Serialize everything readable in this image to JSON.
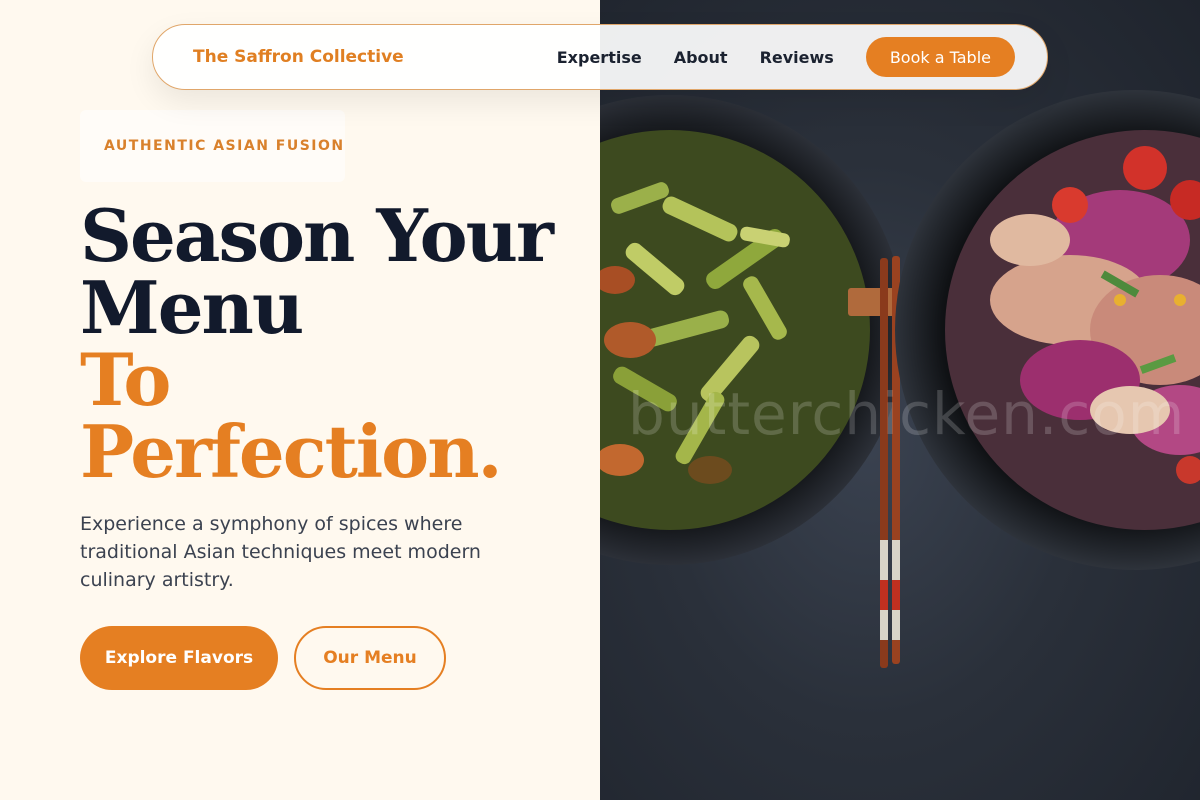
{
  "nav": {
    "brand": "The Saffron Collective",
    "links": [
      "Expertise",
      "About",
      "Reviews"
    ],
    "cta": "Book a Table"
  },
  "hero": {
    "tagline": "AUTHENTIC ASIAN FUSION",
    "headline_line1": "Season Your",
    "headline_line2": "Menu",
    "headline_accent1": "To",
    "headline_accent2": "Perfection.",
    "subtext": "Experience a symphony of spices where traditional Asian techniques meet modern culinary artistry.",
    "primary_button": "Explore Flavors",
    "secondary_button": "Our Menu"
  },
  "image": {
    "watermark": "butterchicken.com",
    "description_icon": "food-bowls-photo"
  },
  "colors": {
    "accent": "#e57f22",
    "heading": "#121a2c",
    "background": "#fff9ef"
  }
}
